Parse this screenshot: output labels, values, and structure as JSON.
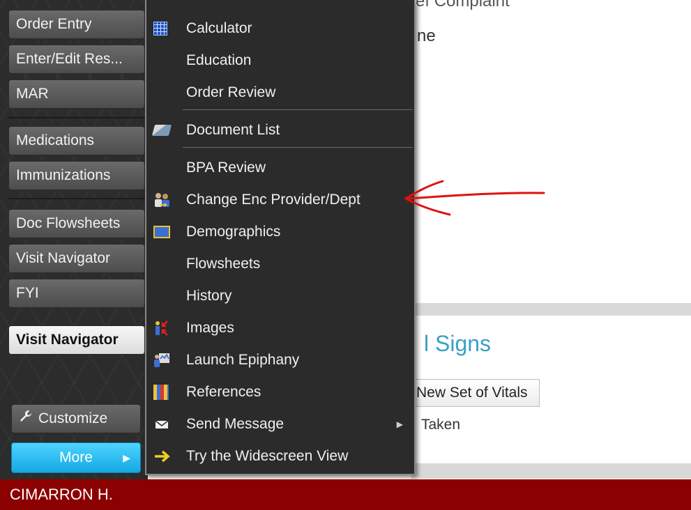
{
  "sidebar": {
    "items": [
      {
        "label": "Order Entry"
      },
      {
        "label": "Enter/Edit Res..."
      },
      {
        "label": "MAR"
      },
      {
        "label": "Medications"
      },
      {
        "label": "Immunizations"
      },
      {
        "label": "Doc Flowsheets"
      },
      {
        "label": "Visit Navigator"
      },
      {
        "label": "FYI"
      }
    ],
    "active_label": "Visit Navigator",
    "customize_label": "Customize",
    "more_label": "More"
  },
  "background": {
    "top_text_1": "Chief Complaint",
    "top_text_2": "ne",
    "vitals_title": "l Signs",
    "new_vitals_button": "New Set of Vitals",
    "taken_text": "Taken"
  },
  "menu": {
    "items": [
      {
        "label": "Calculator",
        "icon": "calculator-icon"
      },
      {
        "label": "Education",
        "icon": ""
      },
      {
        "label": "Order Review",
        "icon": ""
      },
      {
        "label": "Document List",
        "icon": "document-list-icon"
      },
      {
        "label": "BPA Review",
        "icon": ""
      },
      {
        "label": "Change Enc Provider/Dept",
        "icon": "change-provider-icon"
      },
      {
        "label": "Demographics",
        "icon": "demographics-icon"
      },
      {
        "label": "Flowsheets",
        "icon": ""
      },
      {
        "label": "History",
        "icon": ""
      },
      {
        "label": "Images",
        "icon": "images-icon"
      },
      {
        "label": "Launch Epiphany",
        "icon": "epiphany-icon"
      },
      {
        "label": "References",
        "icon": "references-icon"
      },
      {
        "label": "Send Message",
        "icon": "envelope-icon"
      },
      {
        "label": "Try the Widescreen View",
        "icon": "arrow-right-icon"
      }
    ]
  },
  "status_bar": {
    "user": "CIMARRON H."
  },
  "colors": {
    "status_bar": "#8b0000",
    "more_button": "#12a8e4",
    "annotation": "#e01010",
    "vitals_title": "#3a9fc8"
  }
}
